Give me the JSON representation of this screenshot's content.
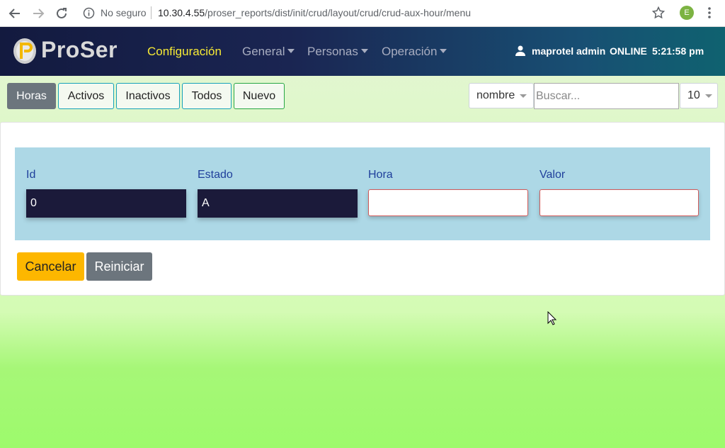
{
  "browser": {
    "security_label": "No seguro",
    "url_host": "10.30.4.55",
    "url_path": "/proser_reports/dist/init/crud/layout/crud/crud-aux-hour/menu",
    "profile_initial": "E"
  },
  "navbar": {
    "logo_text": "ProSer",
    "items": [
      {
        "label": "Configuración"
      },
      {
        "label": "General"
      },
      {
        "label": "Personas"
      },
      {
        "label": "Operación"
      }
    ],
    "user_name": "maprotel admin",
    "status": "ONLINE",
    "time": "5:21:58 pm"
  },
  "toolbar": {
    "buttons": [
      {
        "label": "Horas"
      },
      {
        "label": "Activos"
      },
      {
        "label": "Inactivos"
      },
      {
        "label": "Todos"
      },
      {
        "label": "Nuevo"
      }
    ],
    "field_select": "nombre",
    "search_placeholder": "Buscar...",
    "page_size": "10"
  },
  "form": {
    "fields": [
      {
        "label": "Id",
        "value": "0"
      },
      {
        "label": "Estado",
        "value": "A"
      },
      {
        "label": "Hora",
        "value": ""
      },
      {
        "label": "Valor",
        "value": ""
      }
    ],
    "cancel_label": "Cancelar",
    "reset_label": "Reiniciar"
  },
  "colors": {
    "accent_active_nav": "#f7ea35",
    "form_background": "#add8e6",
    "warning_button": "#fdb700",
    "secondary_button": "#6c757d"
  }
}
